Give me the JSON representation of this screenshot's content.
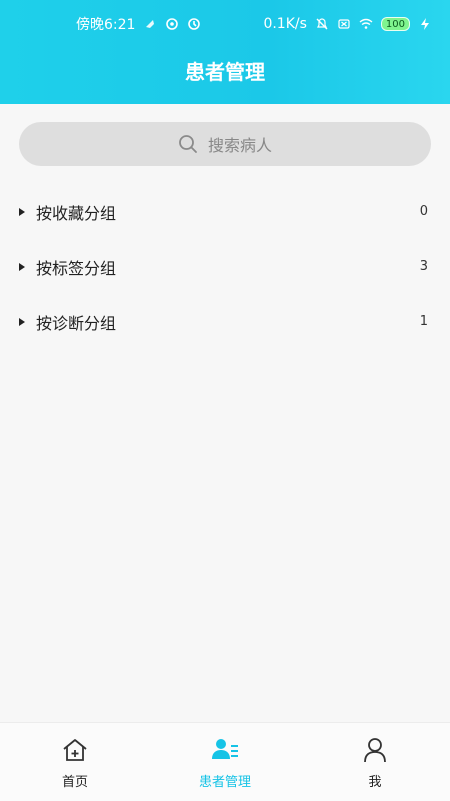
{
  "status_bar": {
    "time": "傍晚6:21",
    "network_speed": "0.1K/s",
    "battery": "100"
  },
  "header": {
    "title": "患者管理"
  },
  "search": {
    "placeholder": "搜索病人"
  },
  "groups": [
    {
      "label": "按收藏分组",
      "count": "0"
    },
    {
      "label": "按标签分组",
      "count": "3"
    },
    {
      "label": "按诊断分组",
      "count": "1"
    }
  ],
  "bottom_nav": {
    "items": [
      {
        "label": "首页",
        "icon": "home-plus-icon"
      },
      {
        "label": "患者管理",
        "icon": "patient-list-icon",
        "active": true
      },
      {
        "label": "我",
        "icon": "person-icon"
      }
    ]
  },
  "colors": {
    "accent": "#16c3e6",
    "header_start": "#1fd0ea",
    "background": "#f7f7f7"
  }
}
